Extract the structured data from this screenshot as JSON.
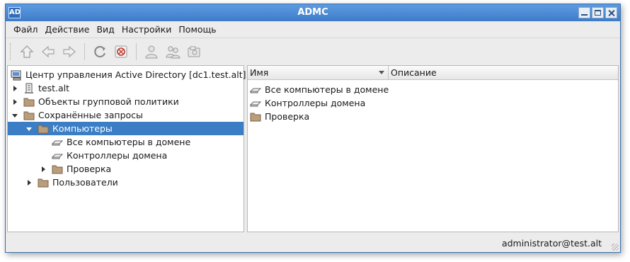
{
  "window": {
    "title": "ADMC",
    "app_icon_text": "AD"
  },
  "menu": [
    {
      "label": "Файл"
    },
    {
      "label": "Действие"
    },
    {
      "label": "Вид"
    },
    {
      "label": "Настройки"
    },
    {
      "label": "Помощь"
    }
  ],
  "toolbar": {
    "icons": [
      "up-icon",
      "back-icon",
      "forward-icon",
      "refresh-icon",
      "stop-icon",
      "user-icon",
      "group-icon",
      "computer-icon"
    ]
  },
  "tree": {
    "root": "Центр управления Active Directory [dc1.test.alt]",
    "domain": "test.alt",
    "gpo": "Объекты групповой политики",
    "saved_queries": "Сохранённые запросы",
    "computers": "Компьютеры",
    "all_computers": "Все компьютеры в домене",
    "domain_controllers": "Контроллеры домена",
    "check": "Проверка",
    "users": "Пользователи"
  },
  "list": {
    "col_name": "Имя",
    "col_description": "Описание",
    "rows": [
      {
        "name": "Все компьютеры в домене"
      },
      {
        "name": "Контроллеры домена"
      },
      {
        "name": "Проверка"
      }
    ]
  },
  "status": {
    "text": "administrator@test.alt"
  },
  "colors": {
    "titlebar": "#3d7cc9",
    "selection": "#3b7ec6",
    "folder": "#b89e7d"
  }
}
